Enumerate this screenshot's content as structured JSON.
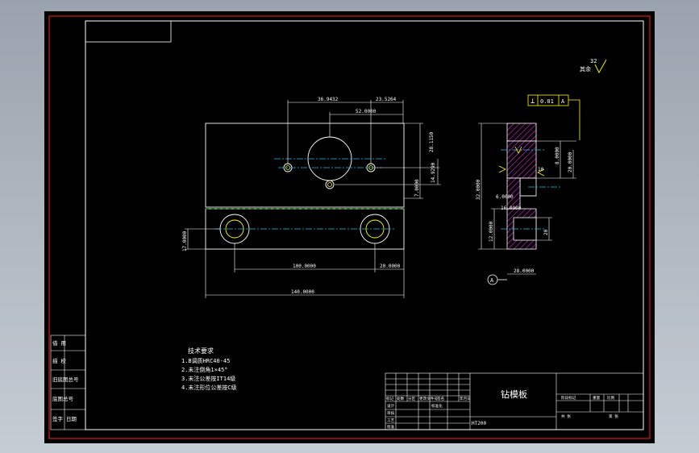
{
  "drawing": {
    "title": "钻模板",
    "scale_note": "HT200",
    "note_title": "技术要求",
    "notes": [
      "1.B调质HRC40-45",
      "2.未注倒角1×45°",
      "3.未注公差按IT14级",
      "4.未注形位公差按C级"
    ],
    "roughness_value": "32",
    "roughness_label": "其余",
    "left_block_labels": [
      "借  用",
      "描  校",
      "旧底图总号",
      "底图总号",
      "签字  日期"
    ],
    "title_block_cells": [
      "标记",
      "处数",
      "分区",
      "更改文件号",
      "签名",
      "年月日",
      "设计",
      "标准化",
      "审核",
      "工艺",
      "批准",
      "阶段标记",
      "重量",
      "比例",
      "共 张",
      "第 张"
    ]
  },
  "dimensions": {
    "top_1": "36.9432",
    "top_2": "23.5264",
    "top_3": "52.0000",
    "right_1": "28.1150",
    "right_2": "14.9290",
    "right_3": "7.0000",
    "left_1": "17.0000",
    "bottom_1": "100.0000",
    "bottom_2": "20.0000",
    "bottom_3": "140.0000",
    "side_1": "32.0000",
    "side_2": "12.0000",
    "side_3": "6.0000",
    "side_4": "20.0000",
    "side_5": "8.0000",
    "side_6": "16.0000",
    "side_7": "20",
    "side_8": "28.0000",
    "side_9": "10",
    "gdt_sym": "⊥",
    "gdt_val": "0.01",
    "gdt_ref": "A",
    "datum_label": "A"
  }
}
